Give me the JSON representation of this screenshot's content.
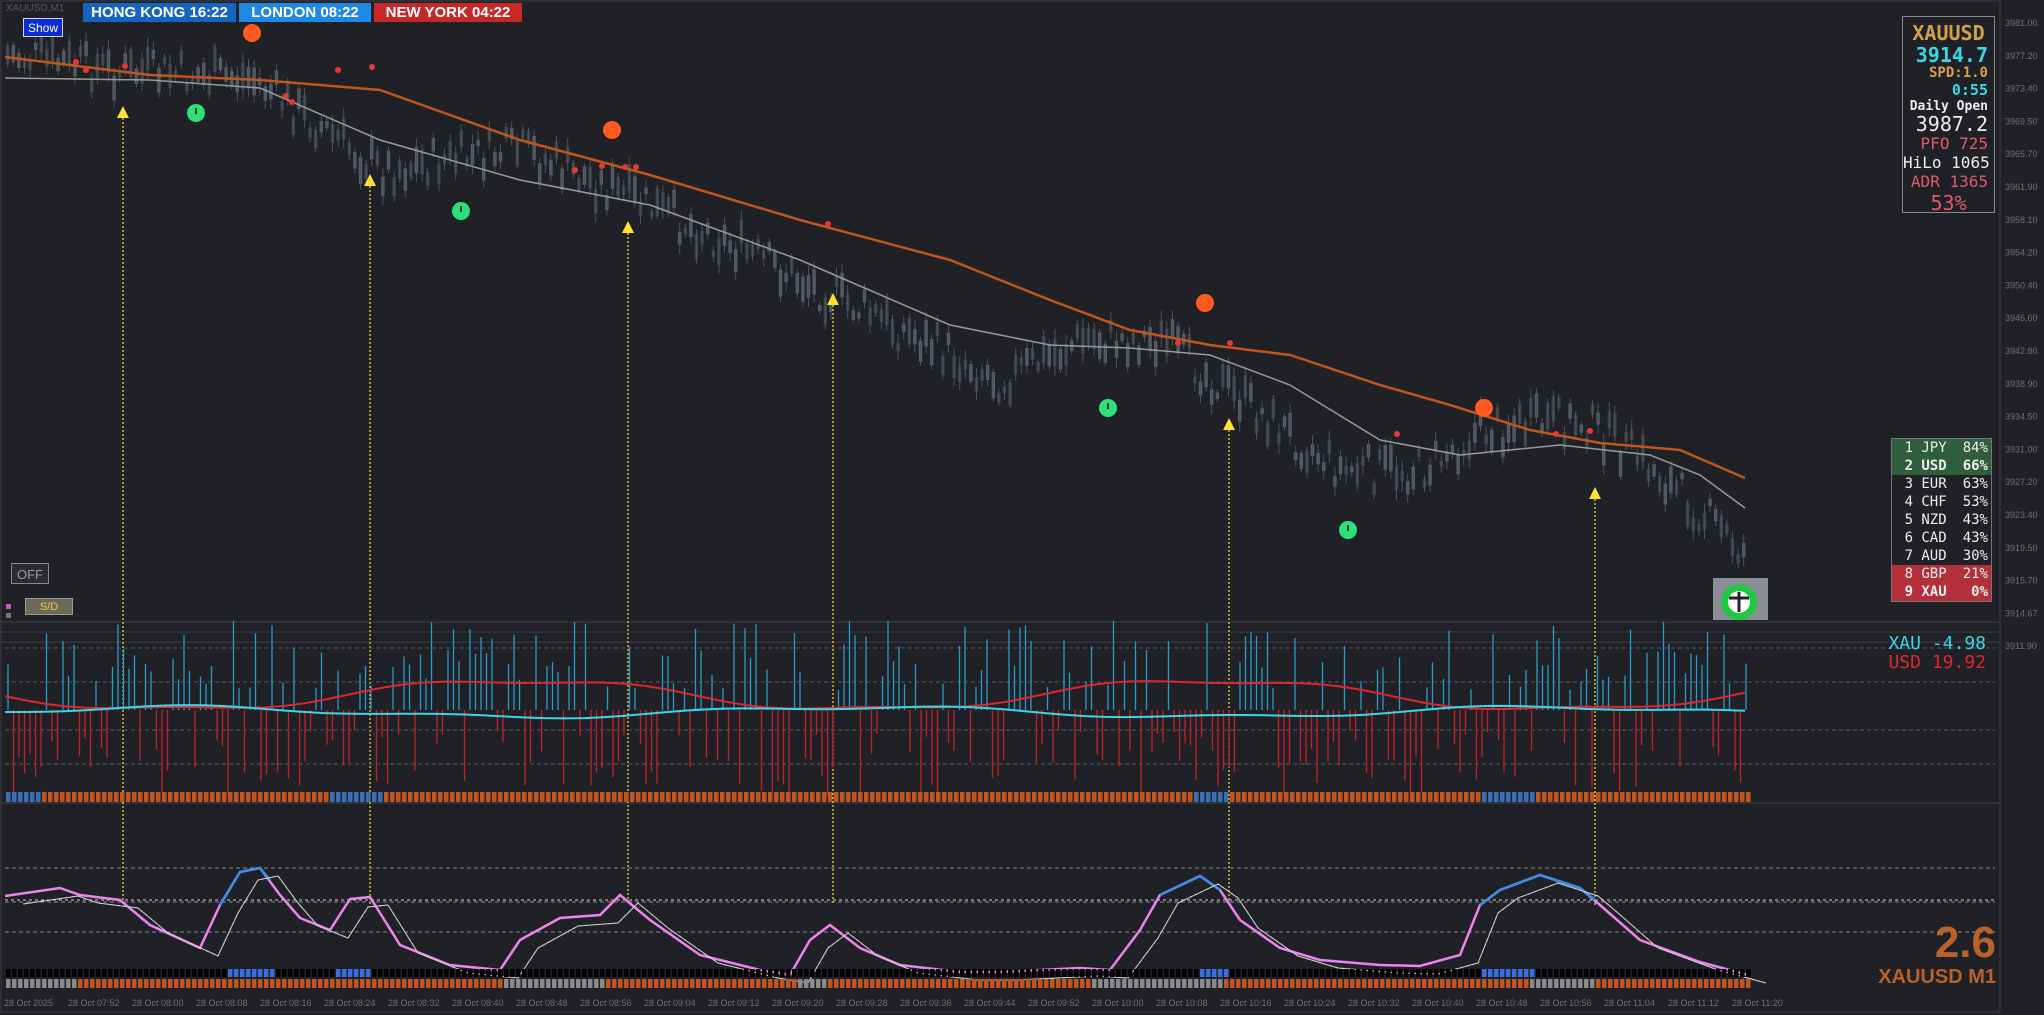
{
  "chart_window_title": "XAUUSD,M1",
  "sessions": [
    {
      "label": "HONG KONG 16:22",
      "color": "#1565c0"
    },
    {
      "label": "LONDON 08:22",
      "color": "#1e88e5"
    },
    {
      "label": "NEW YORK 04:22",
      "color": "#c62828"
    }
  ],
  "buttons": {
    "show": "Show",
    "off": "OFF",
    "sd": "S/D"
  },
  "info_panel": {
    "symbol": "XAUUSD",
    "price": "3914.7",
    "spread": "SPD:1.0",
    "countdown": "0:55",
    "daily_open_label": "Daily Open",
    "daily_open": "3987.2",
    "pfo_label": "PFO",
    "pfo": "725",
    "hilo_label": "HiLo",
    "hilo": "1065",
    "adr_label": "ADR",
    "adr": "1365",
    "adr_pct": "53%"
  },
  "strength_table": [
    {
      "rank": "1",
      "currency": "JPY",
      "pct": "84%",
      "bg": "#2e5e3b",
      "bold": false
    },
    {
      "rank": "2",
      "currency": "USD",
      "pct": "66%",
      "bg": "#2e5e3b",
      "bold": true
    },
    {
      "rank": "3",
      "currency": "EUR",
      "pct": "63%",
      "bg": "#1f2126",
      "bold": false
    },
    {
      "rank": "4",
      "currency": "CHF",
      "pct": "53%",
      "bg": "#1f2126",
      "bold": false
    },
    {
      "rank": "5",
      "currency": "NZD",
      "pct": "43%",
      "bg": "#1f2126",
      "bold": false
    },
    {
      "rank": "6",
      "currency": "CAD",
      "pct": "43%",
      "bg": "#1f2126",
      "bold": false
    },
    {
      "rank": "7",
      "currency": "AUD",
      "pct": "30%",
      "bg": "#1f2126",
      "bold": false
    },
    {
      "rank": "8",
      "currency": "GBP",
      "pct": "21%",
      "bg": "#b3303a",
      "bold": false
    },
    {
      "rank": "9",
      "currency": "XAU",
      "pct": "0%",
      "bg": "#b3303a",
      "bold": true
    }
  ],
  "subwindow_legend": {
    "xau_label": "XAU",
    "xau_value": "-4.98",
    "usd_label": "USD",
    "usd_value": "19.92"
  },
  "footer": {
    "big_value": "2.6",
    "symbol_tf": "XAUUSD M1"
  },
  "colors": {
    "bull": "#2ee07a",
    "bear": "#ff5a1f",
    "ema_slow": "#c0561d",
    "ema_fast": "#9a9a9a",
    "arrow": "#ffe033",
    "xau_line": "#3ad7e6",
    "usd_line": "#e0262d",
    "osc_main": "#ee82ee",
    "osc_hi": "#3a8ee6"
  },
  "price_axis": [
    "3981.00",
    "3977.20",
    "3973.40",
    "3969.50",
    "3965.70",
    "3961.90",
    "3958.10",
    "3954.20",
    "3950.40",
    "3946.60",
    "3942.80",
    "3938.90",
    "3934.50",
    "3931.00",
    "3927.20",
    "3923.40",
    "3919.50",
    "3915.70",
    "3914.67",
    "3911.90"
  ],
  "time_axis": [
    "28 Oct 2025",
    "28 Oct 07:52",
    "28 Oct 08:00",
    "28 Oct 08:08",
    "28 Oct 08:16",
    "28 Oct 08:24",
    "28 Oct 08:32",
    "28 Oct 08:40",
    "28 Oct 08:48",
    "28 Oct 08:56",
    "28 Oct 09:04",
    "28 Oct 09:12",
    "28 Oct 09:20",
    "28 Oct 09:28",
    "28 Oct 09:36",
    "28 Oct 09:44",
    "28 Oct 09:52",
    "28 Oct 10:00",
    "28 Oct 10:08",
    "28 Oct 10:16",
    "28 Oct 10:24",
    "28 Oct 10:32",
    "28 Oct 10:40",
    "28 Oct 10:48",
    "28 Oct 10:56",
    "28 Oct 11:04",
    "28 Oct 11:12",
    "28 Oct 11:20"
  ]
}
